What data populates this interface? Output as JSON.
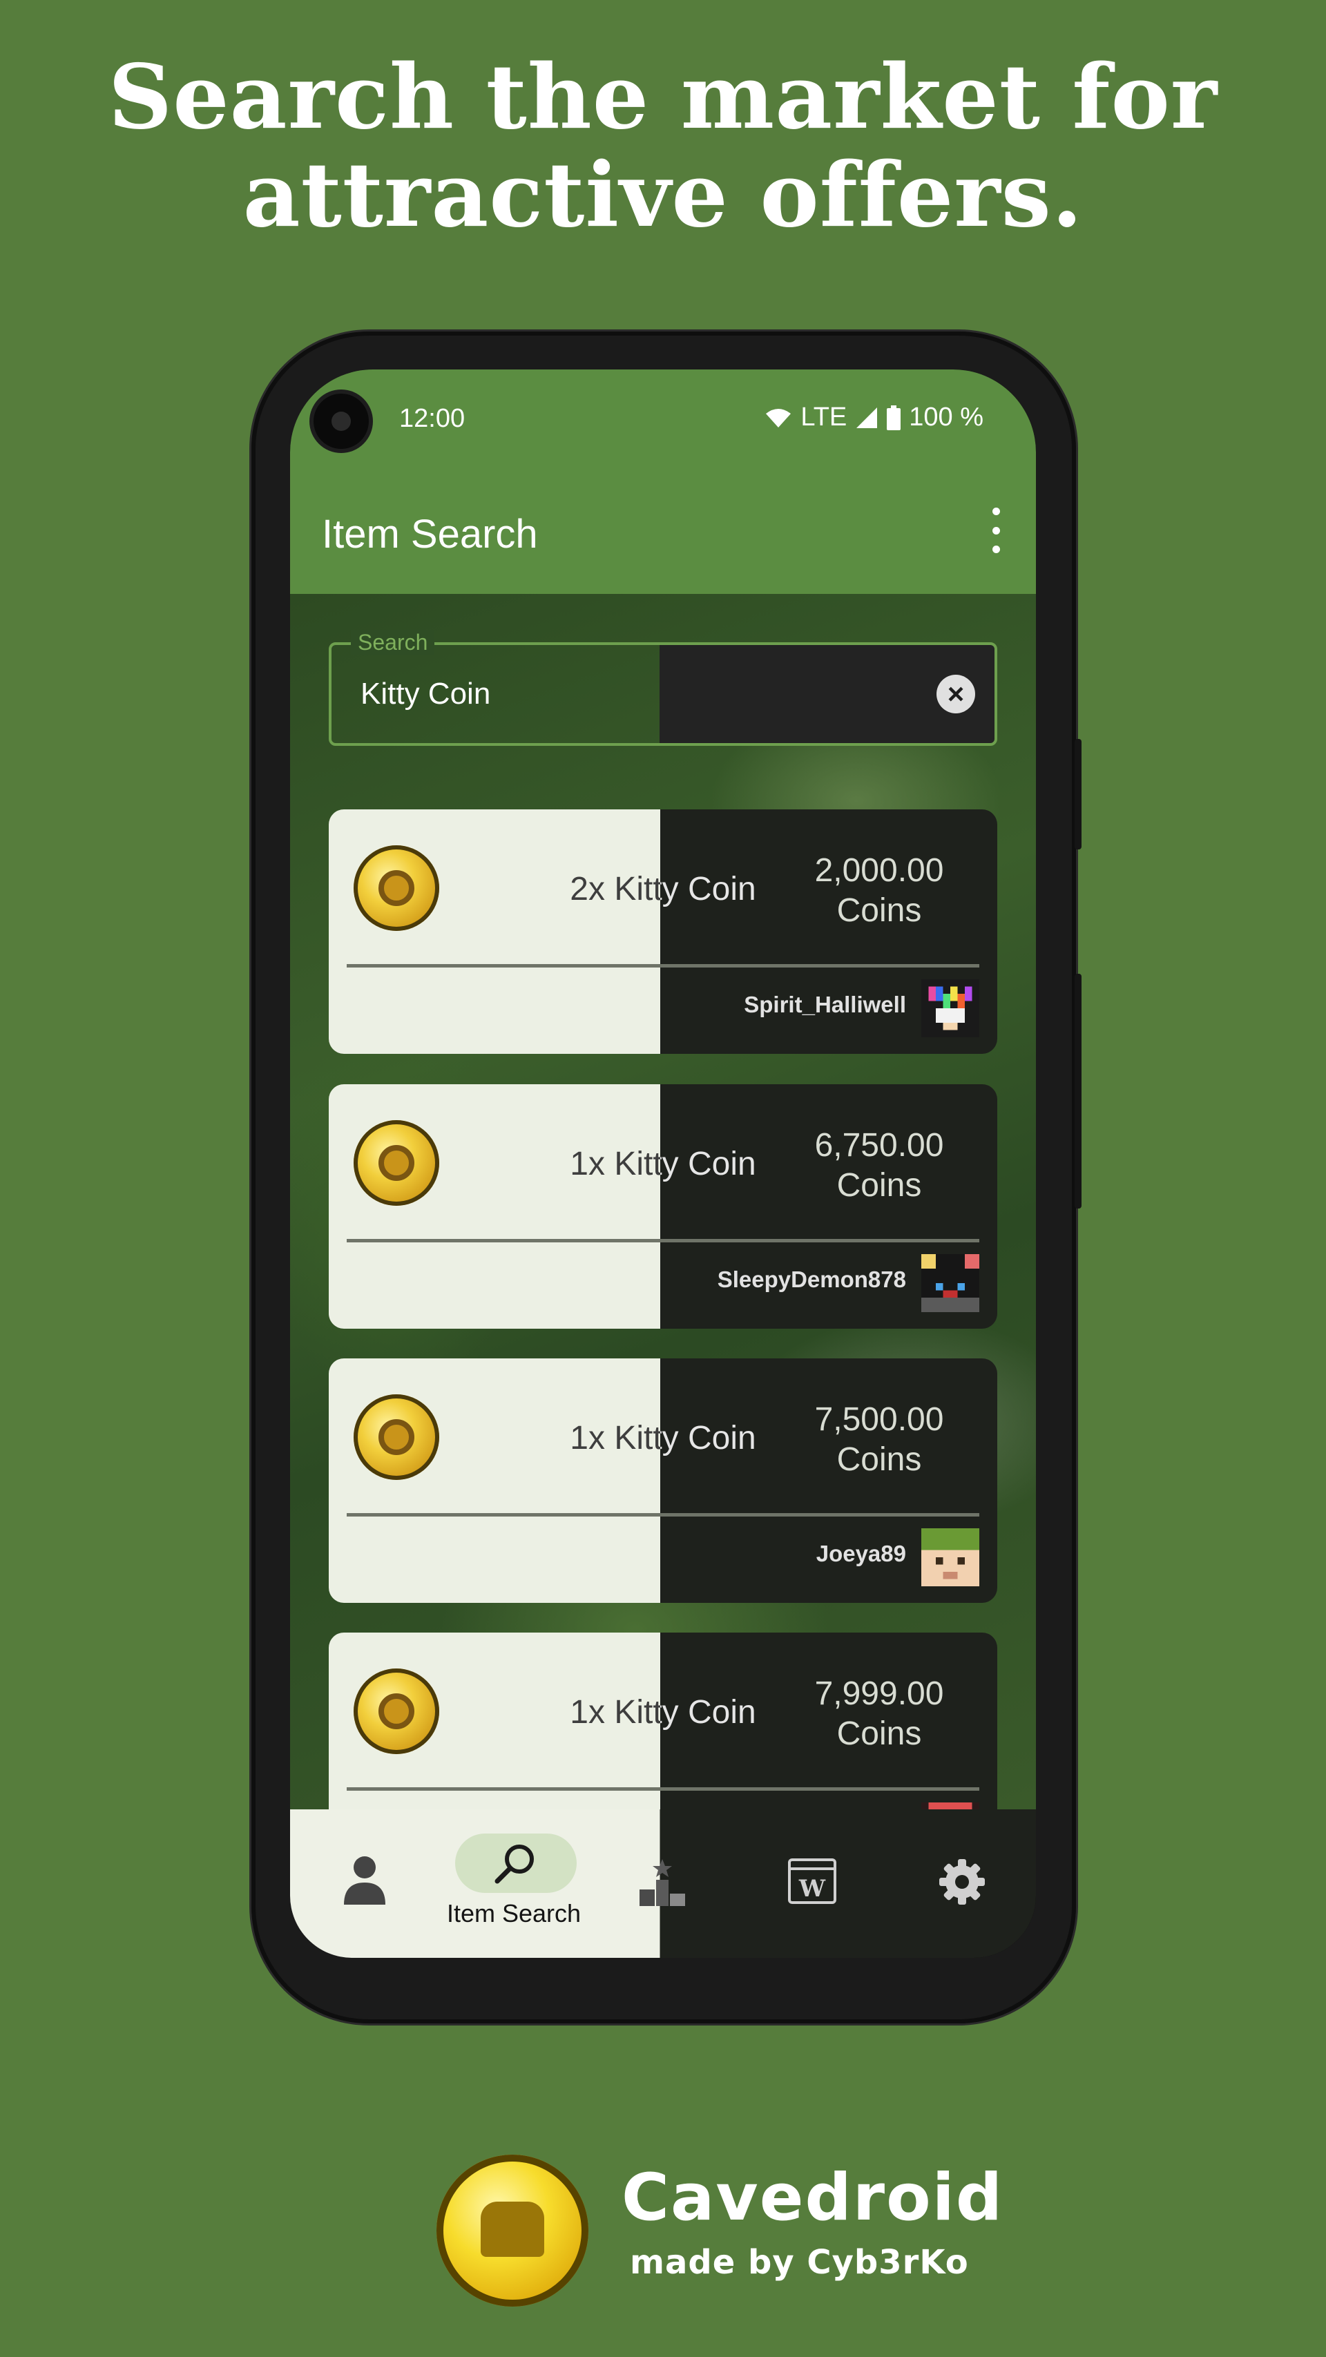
{
  "headline": {
    "line1": "Search the market for",
    "line2": "attractive offers."
  },
  "status": {
    "time": "12:00",
    "network": "LTE",
    "battery": "100 %"
  },
  "appbar": {
    "title": "Item Search"
  },
  "search": {
    "label": "Search",
    "value": "Kitty Coin"
  },
  "listings": [
    {
      "quantity": "2x Kitty Coin",
      "price": "2,000.00",
      "unit": "Coins",
      "seller": "Spirit_Halliwell"
    },
    {
      "quantity": "1x Kitty Coin",
      "price": "6,750.00",
      "unit": "Coins",
      "seller": "SleepyDemon878"
    },
    {
      "quantity": "1x Kitty Coin",
      "price": "7,500.00",
      "unit": "Coins",
      "seller": "Joeya89"
    },
    {
      "quantity": "1x Kitty Coin",
      "price": "7,999.00",
      "unit": "Coins",
      "seller": ""
    }
  ],
  "bottom_nav": {
    "items": [
      {
        "icon": "person-icon",
        "label": ""
      },
      {
        "icon": "search-icon",
        "label": "Item Search",
        "selected": true
      },
      {
        "icon": "leaderboard-icon",
        "label": ""
      },
      {
        "icon": "wiki-icon",
        "label": ""
      },
      {
        "icon": "gear-icon",
        "label": ""
      }
    ]
  },
  "branding": {
    "name": "Cavedroid",
    "subtitle": "made by Cyb3rKo"
  },
  "colors": {
    "background": "#567d3c",
    "appbar": "#5b8d41",
    "accent": "#6ea04e"
  }
}
